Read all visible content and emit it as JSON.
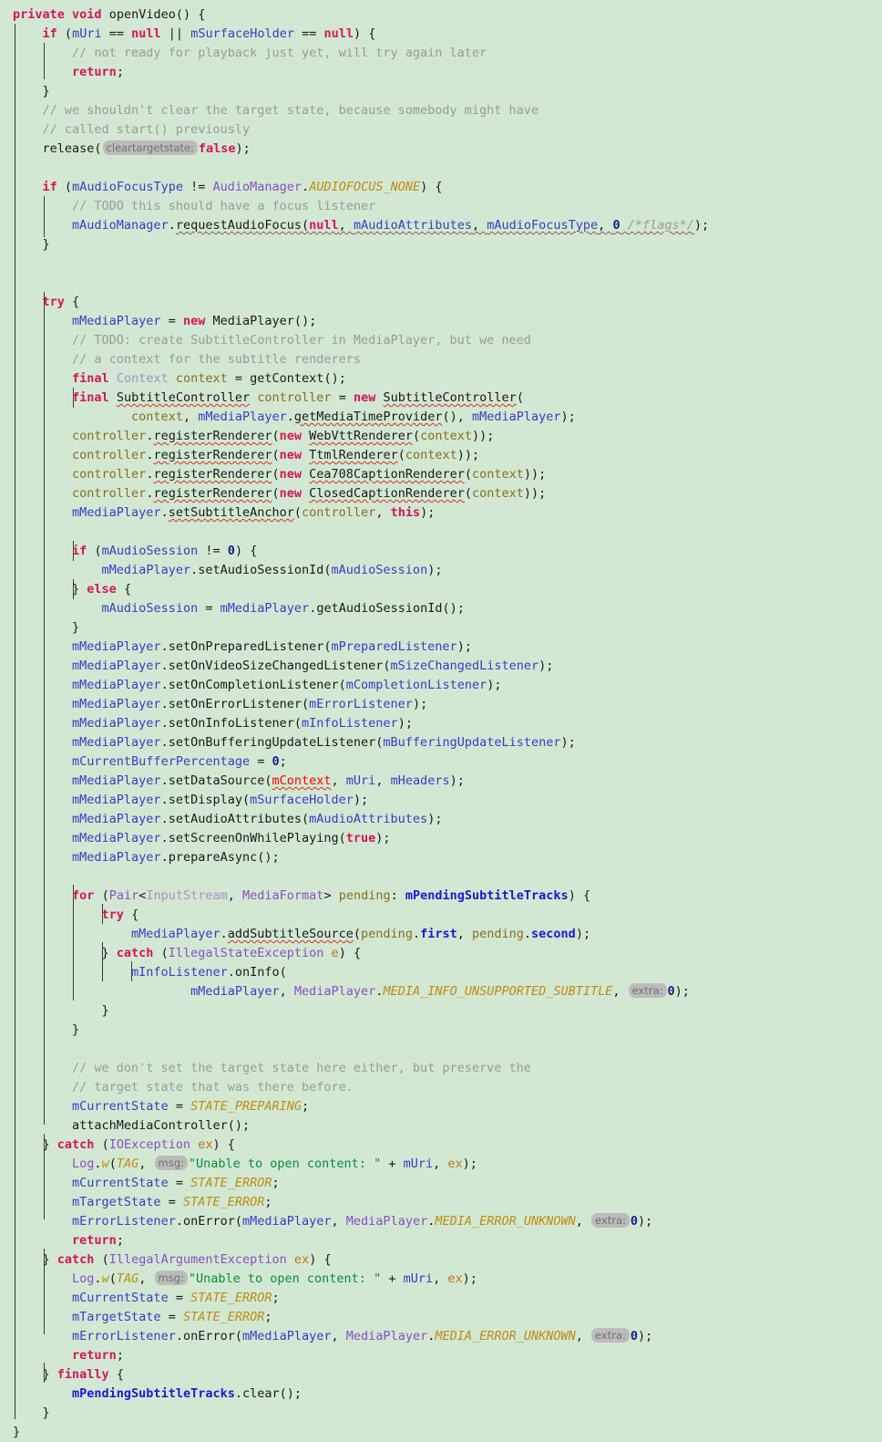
{
  "editor": {
    "language": "java",
    "background_color": "#d2e8d2",
    "font_size_px": 13.5,
    "line_height_px": 21,
    "colors": {
      "keyword": "#d4145a",
      "comment": "#9a9a9a",
      "string": "#0b8a3e",
      "number": "#1a1a8c",
      "field": "#3b3bc4",
      "instance_field_bold": "#1a1ad0",
      "class_name": "#8a4fc4",
      "static_constant": "#bf8b12",
      "parameter": "#8a6d1f",
      "error": "#ff0000",
      "hint_chip_bg": "#bcbcbc",
      "hint_chip_fg": "#707070",
      "indent_guide": "#3b3b3b"
    },
    "parameter_hints": [
      "cleartargetstate:",
      "extra:",
      "msg:"
    ],
    "code_lines": [
      "private void openVideo() {",
      "    if (mUri == null || mSurfaceHolder == null) {",
      "        // not ready for playback just yet, will try again later",
      "        return;",
      "    }",
      "    // we shouldn't clear the target state, because somebody might have",
      "    // called start() previously",
      "    release( cleartargetstate: false);",
      "",
      "    if (mAudioFocusType != AudioManager.AUDIOFOCUS_NONE) {",
      "        // TODO this should have a focus listener",
      "        mAudioManager.requestAudioFocus(null, mAudioAttributes, mAudioFocusType, 0 /*flags*/);",
      "    }",
      "",
      "",
      "    try {",
      "        mMediaPlayer = new MediaPlayer();",
      "        // TODO: create SubtitleController in MediaPlayer, but we need",
      "        // a context for the subtitle renderers",
      "        final Context context = getContext();",
      "        final SubtitleController controller = new SubtitleController(",
      "                context, mMediaPlayer.getMediaTimeProvider(), mMediaPlayer);",
      "        controller.registerRenderer(new WebVttRenderer(context));",
      "        controller.registerRenderer(new TtmlRenderer(context));",
      "        controller.registerRenderer(new Cea708CaptionRenderer(context));",
      "        controller.registerRenderer(new ClosedCaptionRenderer(context));",
      "        mMediaPlayer.setSubtitleAnchor(controller, this);",
      "",
      "        if (mAudioSession != 0) {",
      "            mMediaPlayer.setAudioSessionId(mAudioSession);",
      "        } else {",
      "            mAudioSession = mMediaPlayer.getAudioSessionId();",
      "        }",
      "        mMediaPlayer.setOnPreparedListener(mPreparedListener);",
      "        mMediaPlayer.setOnVideoSizeChangedListener(mSizeChangedListener);",
      "        mMediaPlayer.setOnCompletionListener(mCompletionListener);",
      "        mMediaPlayer.setOnErrorListener(mErrorListener);",
      "        mMediaPlayer.setOnInfoListener(mInfoListener);",
      "        mMediaPlayer.setOnBufferingUpdateListener(mBufferingUpdateListener);",
      "        mCurrentBufferPercentage = 0;",
      "        mMediaPlayer.setDataSource(mContext, mUri, mHeaders);",
      "        mMediaPlayer.setDisplay(mSurfaceHolder);",
      "        mMediaPlayer.setAudioAttributes(mAudioAttributes);",
      "        mMediaPlayer.setScreenOnWhilePlaying(true);",
      "        mMediaPlayer.prepareAsync();",
      "",
      "        for (Pair<InputStream, MediaFormat> pending: mPendingSubtitleTracks) {",
      "            try {",
      "                mMediaPlayer.addSubtitleSource(pending.first, pending.second);",
      "            } catch (IllegalStateException e) {",
      "                mInfoListener.onInfo(",
      "                        mMediaPlayer, MediaPlayer.MEDIA_INFO_UNSUPPORTED_SUBTITLE,  extra: 0);",
      "            }",
      "        }",
      "",
      "        // we don't set the target state here either, but preserve the",
      "        // target state that was there before.",
      "        mCurrentState = STATE_PREPARING;",
      "        attachMediaController();",
      "    } catch (IOException ex) {",
      "        Log.w(TAG,  msg: \"Unable to open content: \" + mUri, ex);",
      "        mCurrentState = STATE_ERROR;",
      "        mTargetState = STATE_ERROR;",
      "        mErrorListener.onError(mMediaPlayer, MediaPlayer.MEDIA_ERROR_UNKNOWN,  extra: 0);",
      "        return;",
      "    } catch (IllegalArgumentException ex) {",
      "        Log.w(TAG,  msg: \"Unable to open content: \" + mUri, ex);",
      "        mCurrentState = STATE_ERROR;",
      "        mTargetState = STATE_ERROR;",
      "        mErrorListener.onError(mMediaPlayer, MediaPlayer.MEDIA_ERROR_UNKNOWN,  extra: 0);",
      "        return;",
      "    } finally {",
      "        mPendingSubtitleTracks.clear();",
      "    }",
      "}"
    ],
    "error_symbols": [
      "mContext"
    ],
    "warning_symbols": [
      "SubtitleController",
      "getMediaTimeProvider",
      "registerRenderer",
      "WebVttRenderer",
      "TtmlRenderer",
      "Cea708CaptionRenderer",
      "ClosedCaptionRenderer",
      "setSubtitleAnchor",
      "addSubtitleSource",
      "requestAudioFocus"
    ]
  }
}
